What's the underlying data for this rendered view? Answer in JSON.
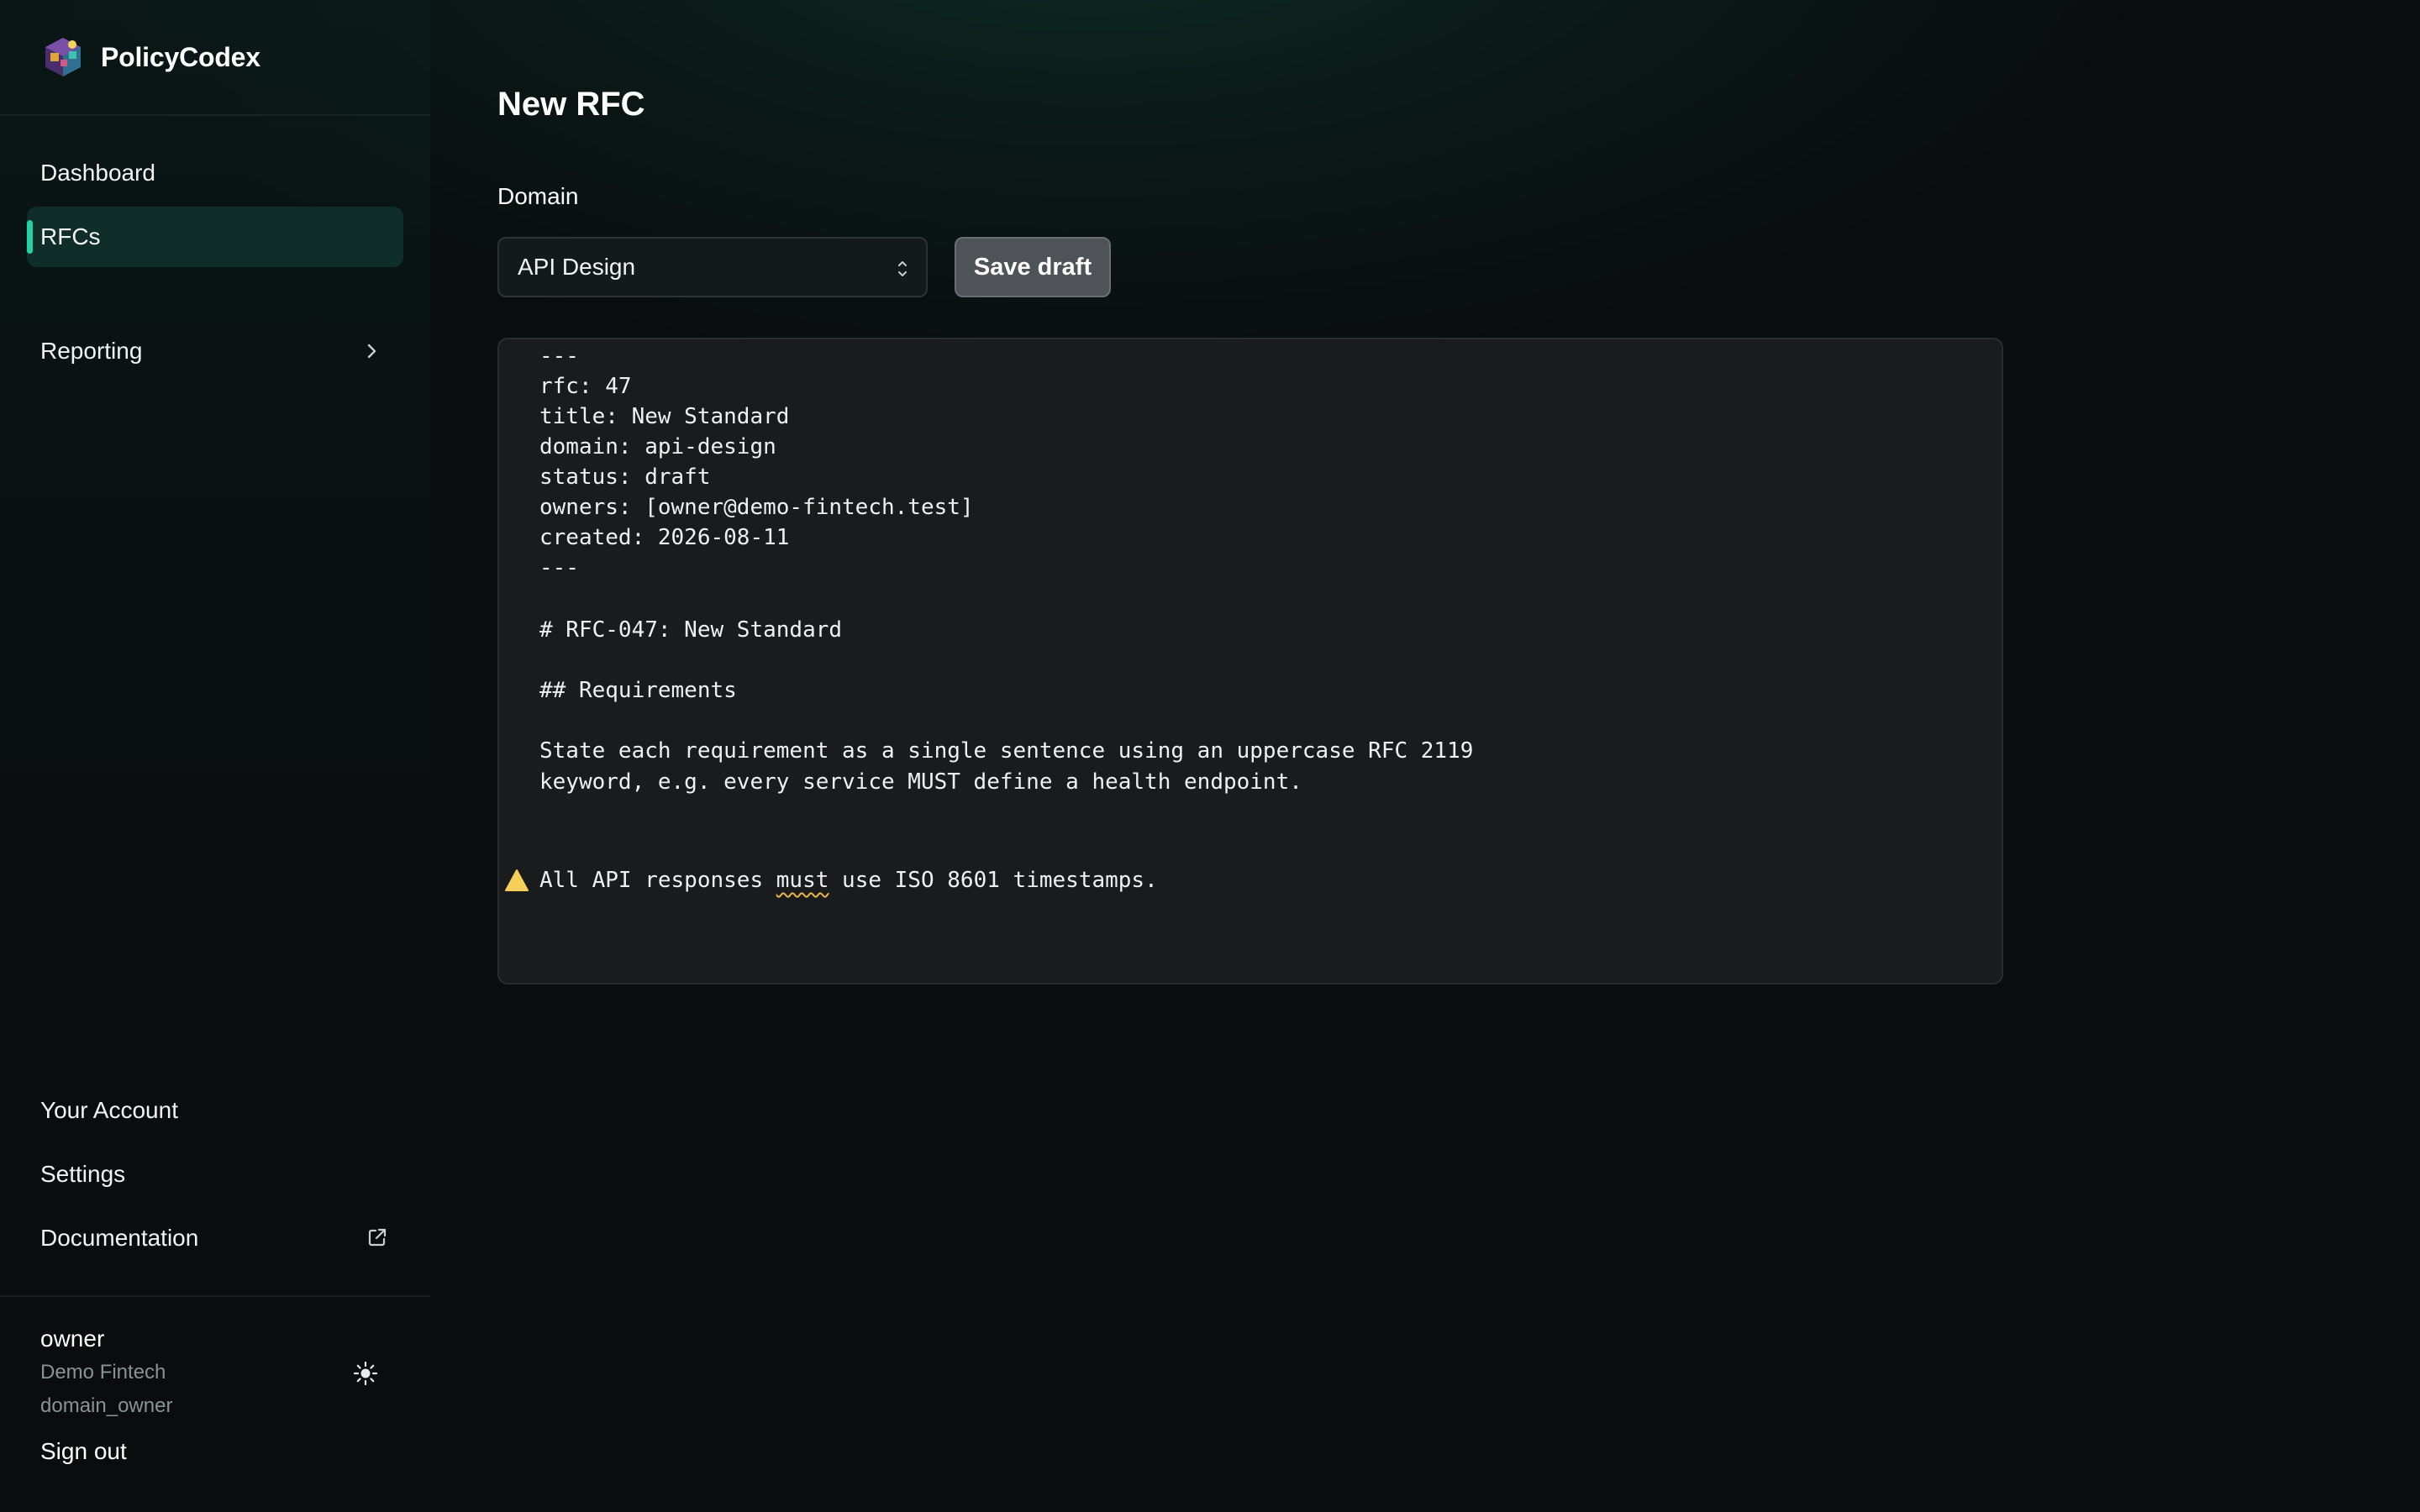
{
  "app": {
    "name": "PolicyCodex"
  },
  "sidebar": {
    "nav": [
      {
        "label": "Dashboard"
      },
      {
        "label": "RFCs",
        "active": true
      },
      {
        "label": "Reporting"
      }
    ],
    "bottom": [
      {
        "label": "Your Account"
      },
      {
        "label": "Settings"
      },
      {
        "label": "Documentation"
      }
    ],
    "user": {
      "name": "owner",
      "org": "Demo Fintech",
      "role": "domain_owner",
      "signout_label": "Sign out"
    }
  },
  "main": {
    "title": "New RFC",
    "domain_label": "Domain",
    "domain_value": "API Design",
    "save_label": "Save draft",
    "editor_lines": [
      "---",
      "rfc: 47",
      "title: New Standard",
      "domain: api-design",
      "status: draft",
      "owners: [owner@demo-fintech.test]",
      "created: 2026-08-11",
      "---",
      "",
      "# RFC-047: New Standard",
      "",
      "## Requirements",
      "",
      "State each requirement as a single sentence using an uppercase RFC 2119",
      "keyword, e.g. every service MUST define a health endpoint.",
      "",
      ""
    ],
    "warning_line": {
      "before": "All API responses ",
      "flagged": "must",
      "after": " use ISO 8601 timestamps."
    }
  },
  "colors": {
    "accent": "#1fd1a3",
    "active_nav_bg": "#0f2e29",
    "warning": "#f5cf5a",
    "editor_bg": "#1a1b1d"
  },
  "icons": {
    "reporting": "chevron-right-icon",
    "documentation": "external-link-icon",
    "theme": "sun-icon",
    "select": "chevron-updown-icon",
    "warning": "warning-triangle-icon"
  }
}
